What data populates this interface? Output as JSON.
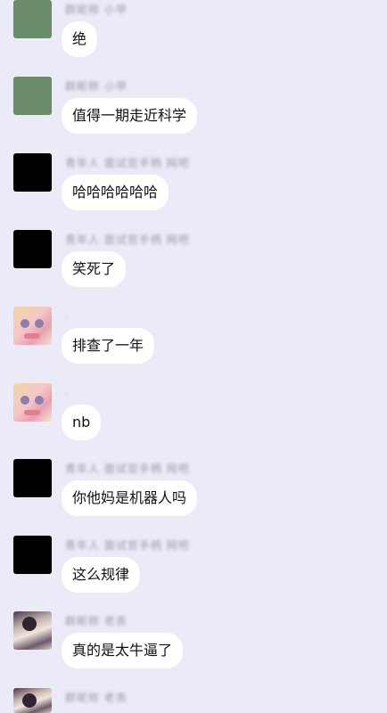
{
  "messages": [
    {
      "name": "群昵称 小甲",
      "text": "绝",
      "avatar": "green-square"
    },
    {
      "name": "群昵称 小甲",
      "text": "值得一期走近科学",
      "avatar": "green-square"
    },
    {
      "name": "青年人 面试官手柄 网吧",
      "text": "哈哈哈哈哈哈",
      "avatar": "black-square"
    },
    {
      "name": "青年人 面试官手柄 网吧",
      "text": "笑死了",
      "avatar": "black-square"
    },
    {
      "name": ".",
      "text": "排查了一年",
      "avatar": "anime-girl"
    },
    {
      "name": ".",
      "text": "nb",
      "avatar": "anime-girl"
    },
    {
      "name": "青年人 面试官手柄 网吧",
      "text": "你他妈是机器人吗",
      "avatar": "black-square"
    },
    {
      "name": "青年人 面试官手柄 网吧",
      "text": "这么规律",
      "avatar": "black-square"
    },
    {
      "name": "群昵称 老表",
      "text": "真的是太牛逼了",
      "avatar": "photo"
    },
    {
      "name": "群昵称 老表",
      "text": "",
      "avatar": "photo"
    }
  ]
}
